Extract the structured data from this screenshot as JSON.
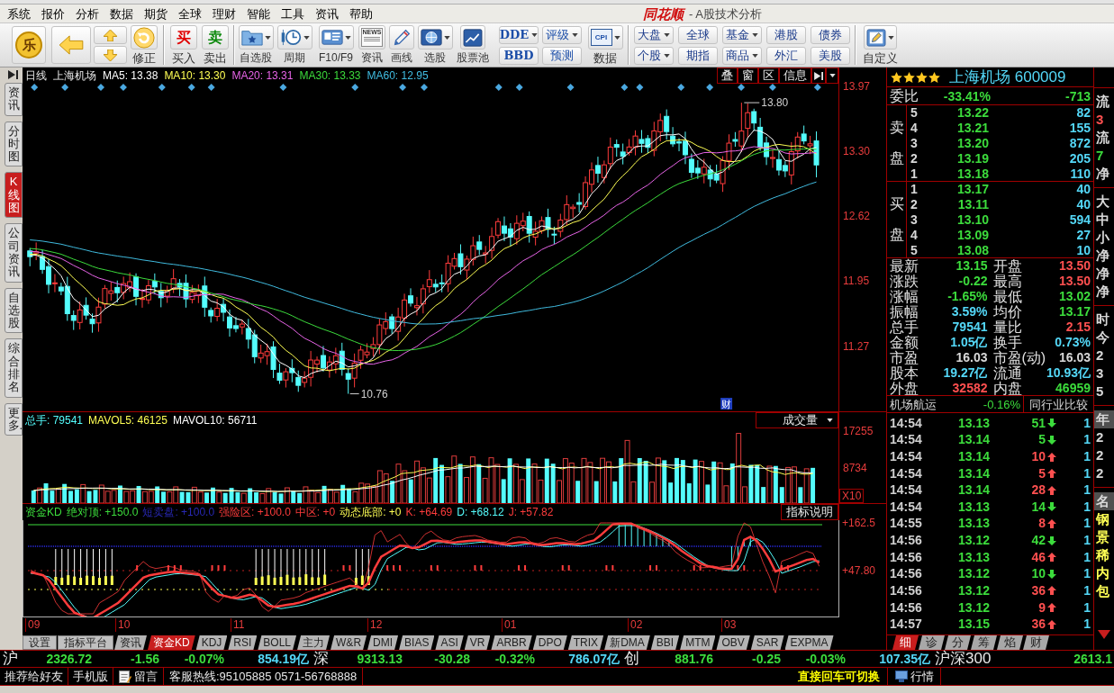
{
  "menu": [
    "系统",
    "报价",
    "分析",
    "数据",
    "期货",
    "全球",
    "理财",
    "智能",
    "工具",
    "资讯",
    "帮助"
  ],
  "title": {
    "logo": "同花顺",
    "caption": "- A股技术分析"
  },
  "toolbar": {
    "home": "乐",
    "fix": "修正",
    "trade": [
      {
        "icon_text": "买",
        "label": "买入",
        "color": "#e00000"
      },
      {
        "icon_text": "卖",
        "label": "卖出",
        "color": "#108a10"
      }
    ],
    "tools": [
      {
        "label": "自选股",
        "dropdown": true
      },
      {
        "label": "周期",
        "dropdown": true
      },
      {
        "label": "F10/F9",
        "dropdown": true
      },
      {
        "label": "资讯",
        "dropdown": false,
        "icon_text": "NEWS"
      },
      {
        "label": "画线",
        "dropdown": false
      },
      {
        "label": "选股",
        "dropdown": true
      },
      {
        "label": "股票池",
        "dropdown": false
      }
    ],
    "pairs": [
      [
        {
          "label": "DDE",
          "dropdown": true
        },
        {
          "label": "BBD",
          "dropdown": false
        }
      ],
      [
        {
          "label": "评级",
          "dropdown": true
        },
        {
          "label": "预测",
          "dropdown": false
        }
      ]
    ],
    "data": {
      "icon_text": "CPI",
      "label": "数据",
      "dropdown": true
    },
    "markets": [
      [
        {
          "label": "大盘",
          "dropdown": true
        },
        {
          "label": "个股",
          "dropdown": true
        }
      ],
      [
        {
          "label": "全球",
          "dropdown": false
        },
        {
          "label": "期指",
          "dropdown": false
        }
      ],
      [
        {
          "label": "基金",
          "dropdown": true
        },
        {
          "label": "商品",
          "dropdown": true
        }
      ],
      [
        {
          "label": "港股",
          "dropdown": false
        },
        {
          "label": "外汇",
          "dropdown": false
        }
      ],
      [
        {
          "label": "债券",
          "dropdown": false
        },
        {
          "label": "美股",
          "dropdown": false
        }
      ]
    ],
    "custom": {
      "label": "自定义",
      "dropdown": true
    }
  },
  "side_tabs": [
    {
      "label": "资讯",
      "selected": false
    },
    {
      "label": "分时图",
      "selected": false
    },
    {
      "label": "K线图",
      "selected": true
    },
    {
      "label": "公司资讯",
      "selected": false
    },
    {
      "label": "自选股",
      "selected": false
    },
    {
      "label": "综合排名",
      "selected": false
    },
    {
      "label": "更多..",
      "selected": false
    }
  ],
  "kline": {
    "period": "日线",
    "stock": "上海机场",
    "ma": [
      {
        "label": "MA5: 13.38",
        "color": "#ffffff"
      },
      {
        "label": "MA10: 13.30",
        "color": "#ffff54"
      },
      {
        "label": "MA20: 13.31",
        "color": "#e864e8"
      },
      {
        "label": "MA30: 13.33",
        "color": "#3cdc3c"
      },
      {
        "label": "MA60: 12.95",
        "color": "#40bce0"
      }
    ],
    "buttons": [
      "叠",
      "窗",
      "区",
      "信息"
    ],
    "price_ticks": [
      "13.97",
      "13.30",
      "12.62",
      "11.95",
      "11.27"
    ],
    "high_label": "13.80",
    "low_label": "10.76",
    "event_marker": "财"
  },
  "volume": {
    "stats": [
      {
        "label": "总手: 79541",
        "color": "#54fcfc"
      },
      {
        "label": "MAVOL5: 46125",
        "color": "#ffff54"
      },
      {
        "label": "MAVOL10: 56711",
        "color": "#ffffff"
      }
    ],
    "selector": "成交量",
    "ticks": [
      "17255",
      "8734"
    ],
    "unit": "X10"
  },
  "indicator": {
    "items": [
      {
        "label": "资金KD",
        "color": "#3cdc3c"
      },
      {
        "label": "绝对顶: +150.0",
        "color": "#3cdc3c"
      },
      {
        "label": "短卖盘: +100.0",
        "color": "#2828b4"
      },
      {
        "label": "强险区: +100.0",
        "color": "#ff3c3c"
      },
      {
        "label": "中区: +0",
        "color": "#ff3c3c"
      },
      {
        "label": "动态底部: +0",
        "color": "#ffff54"
      },
      {
        "label": "K: +64.69",
        "color": "#ff3c3c"
      },
      {
        "label": "D: +68.12",
        "color": "#54fcfc"
      },
      {
        "label": "J: +57.82",
        "color": "#ff3c3c"
      }
    ],
    "help_button": "指标说明",
    "ticks": [
      "+162.5",
      "+47.80"
    ]
  },
  "months": [
    "09",
    "10",
    "11",
    "12",
    "01",
    "02",
    "03"
  ],
  "indicator_tabs": [
    {
      "label": "设置",
      "kind": "button",
      "selected": false
    },
    {
      "label": "指标平台",
      "kind": "button",
      "selected": false
    },
    {
      "label": "资讯",
      "kind": "tab",
      "selected": false
    },
    {
      "label": "资金KD",
      "kind": "tab",
      "selected": true
    },
    {
      "label": "KDJ",
      "kind": "tab",
      "selected": false
    },
    {
      "label": "RSI",
      "kind": "tab",
      "selected": false
    },
    {
      "label": "BOLL",
      "kind": "tab",
      "selected": false
    },
    {
      "label": "主力",
      "kind": "tab",
      "selected": false
    },
    {
      "label": "W&R",
      "kind": "tab",
      "selected": false
    },
    {
      "label": "DMI",
      "kind": "tab",
      "selected": false
    },
    {
      "label": "BIAS",
      "kind": "tab",
      "selected": false
    },
    {
      "label": "ASI",
      "kind": "tab",
      "selected": false
    },
    {
      "label": "VR",
      "kind": "tab",
      "selected": false
    },
    {
      "label": "ARBR",
      "kind": "tab",
      "selected": false
    },
    {
      "label": "DPO",
      "kind": "tab",
      "selected": false
    },
    {
      "label": "TRIX",
      "kind": "tab",
      "selected": false
    },
    {
      "label": "新DMA",
      "kind": "tab",
      "selected": false
    },
    {
      "label": "BBI",
      "kind": "tab",
      "selected": false
    },
    {
      "label": "MTM",
      "kind": "tab",
      "selected": false
    },
    {
      "label": "OBV",
      "kind": "tab",
      "selected": false
    },
    {
      "label": "SAR",
      "kind": "tab",
      "selected": false
    },
    {
      "label": "EXPMA",
      "kind": "tab",
      "selected": false
    }
  ],
  "quote": {
    "stars": 4,
    "name": "上海机场 600009",
    "ratio": {
      "label": "委比",
      "percent": "-33.41%",
      "diff": "-713"
    },
    "asks": {
      "label": "卖盘",
      "rows": [
        {
          "rank": "5",
          "price": "13.22",
          "volume": "82"
        },
        {
          "rank": "4",
          "price": "13.21",
          "volume": "155"
        },
        {
          "rank": "3",
          "price": "13.20",
          "volume": "872"
        },
        {
          "rank": "2",
          "price": "13.19",
          "volume": "205"
        },
        {
          "rank": "1",
          "price": "13.18",
          "volume": "110"
        }
      ]
    },
    "bids": {
      "label": "买盘",
      "rows": [
        {
          "rank": "1",
          "price": "13.17",
          "volume": "40"
        },
        {
          "rank": "2",
          "price": "13.11",
          "volume": "40"
        },
        {
          "rank": "3",
          "price": "13.10",
          "volume": "594"
        },
        {
          "rank": "4",
          "price": "13.09",
          "volume": "27"
        },
        {
          "rank": "5",
          "price": "13.08",
          "volume": "10"
        }
      ]
    },
    "stats": [
      {
        "label": "最新",
        "value": "13.15",
        "color": "#3cdc3c"
      },
      {
        "label": "开盘",
        "value": "13.50",
        "color": "#ff5050"
      },
      {
        "label": "涨跌",
        "value": "-0.22",
        "color": "#3cdc3c"
      },
      {
        "label": "最高",
        "value": "13.50",
        "color": "#ff5050"
      },
      {
        "label": "涨幅",
        "value": "-1.65%",
        "color": "#3cdc3c"
      },
      {
        "label": "最低",
        "value": "13.02",
        "color": "#3cdc3c"
      },
      {
        "label": "振幅",
        "value": "3.59%",
        "color": "#54d8f8"
      },
      {
        "label": "均价",
        "value": "13.17",
        "color": "#3cdc3c"
      },
      {
        "label": "总手",
        "value": "79541",
        "color": "#54d8f8"
      },
      {
        "label": "量比",
        "value": "2.15",
        "color": "#ff5050"
      },
      {
        "label": "金额",
        "value": "1.05亿",
        "color": "#54d8f8"
      },
      {
        "label": "换手",
        "value": "0.73%",
        "color": "#54d8f8"
      },
      {
        "label": "市盈",
        "value": "16.03",
        "color": "#d8d8d8"
      },
      {
        "label": "市盈(动)",
        "value": "16.03",
        "color": "#d8d8d8"
      },
      {
        "label": "股本",
        "value": "19.27亿",
        "color": "#54d8f8"
      },
      {
        "label": "流通",
        "value": "10.93亿",
        "color": "#54d8f8"
      },
      {
        "label": "外盘",
        "value": "32582",
        "color": "#ff5050"
      },
      {
        "label": "内盘",
        "value": "46959",
        "color": "#3cdc3c"
      }
    ],
    "industry": {
      "name": "机场航运",
      "change": "-0.16%",
      "button": "同行业比较"
    },
    "ticks": [
      {
        "time": "14:54",
        "price": "13.13",
        "volume": "51",
        "kind": "down",
        "column_4": "1"
      },
      {
        "time": "14:54",
        "price": "13.14",
        "volume": "5",
        "kind": "down",
        "column_4": "1"
      },
      {
        "time": "14:54",
        "price": "13.14",
        "volume": "10",
        "kind": "up",
        "column_4": "1"
      },
      {
        "time": "14:54",
        "price": "13.14",
        "volume": "5",
        "kind": "up",
        "column_4": "1"
      },
      {
        "time": "14:54",
        "price": "13.14",
        "volume": "28",
        "kind": "up",
        "column_4": "1"
      },
      {
        "time": "14:54",
        "price": "13.13",
        "volume": "14",
        "kind": "down",
        "column_4": "1"
      },
      {
        "time": "14:55",
        "price": "13.13",
        "volume": "8",
        "kind": "up",
        "column_4": "1"
      },
      {
        "time": "14:56",
        "price": "13.12",
        "volume": "42",
        "kind": "down",
        "column_4": "1"
      },
      {
        "time": "14:56",
        "price": "13.13",
        "volume": "46",
        "kind": "up",
        "column_4": "1"
      },
      {
        "time": "14:56",
        "price": "13.12",
        "volume": "10",
        "kind": "down",
        "column_4": "1"
      },
      {
        "time": "14:56",
        "price": "13.12",
        "volume": "36",
        "kind": "up",
        "column_4": "1"
      },
      {
        "time": "14:56",
        "price": "13.12",
        "volume": "9",
        "kind": "up",
        "column_4": "1"
      },
      {
        "time": "14:57",
        "price": "13.15",
        "volume": "36",
        "kind": "up",
        "column_4": "1"
      }
    ],
    "tabs": [
      {
        "label": "细",
        "selected": true
      },
      {
        "label": "诊",
        "selected": false
      },
      {
        "label": "分",
        "selected": false
      },
      {
        "label": "筹",
        "selected": false
      },
      {
        "label": "焰",
        "selected": false
      },
      {
        "label": "财",
        "selected": false
      }
    ]
  },
  "side_panel": [
    [
      {
        "text": "流",
        "kind": "text",
        "color": "#d8d8d8"
      },
      {
        "text": "3",
        "kind": "text",
        "color": "#ff5050"
      },
      {
        "text": "流",
        "kind": "text",
        "color": "#d8d8d8"
      },
      {
        "text": "7",
        "kind": "text",
        "color": "#3cdc3c"
      },
      {
        "text": "净",
        "kind": "text",
        "color": "#d8d8d8"
      }
    ],
    [
      {
        "text": "大",
        "kind": "text",
        "color": "#d8d8d8"
      },
      {
        "text": "中",
        "kind": "text",
        "color": "#d8d8d8"
      },
      {
        "text": "小",
        "kind": "text",
        "color": "#d8d8d8"
      },
      {
        "text": "净",
        "kind": "text",
        "color": "#d8d8d8"
      },
      {
        "text": "净",
        "kind": "text",
        "color": "#d8d8d8"
      },
      {
        "text": "净",
        "kind": "text",
        "color": "#d8d8d8"
      }
    ],
    [
      {
        "text": "时",
        "kind": "text",
        "color": "#d8d8d8"
      },
      {
        "text": "今",
        "kind": "text",
        "color": "#d8d8d8"
      },
      {
        "text": "2",
        "kind": "text",
        "color": "#d8d8d8"
      },
      {
        "text": "3",
        "kind": "text",
        "color": "#d8d8d8"
      },
      {
        "text": "5",
        "kind": "text",
        "color": "#d8d8d8"
      }
    ],
    [
      {
        "text": "年",
        "kind": "header"
      },
      {
        "text": "2",
        "kind": "text",
        "color": "#d8d8d8"
      },
      {
        "text": "2",
        "kind": "text",
        "color": "#d8d8d8"
      },
      {
        "text": "2",
        "kind": "text",
        "color": "#d8d8d8"
      }
    ],
    [
      {
        "text": "名",
        "kind": "header"
      },
      {
        "text": "钢",
        "kind": "text",
        "color": "#ffff54"
      },
      {
        "text": "景",
        "kind": "text",
        "color": "#ffff54"
      },
      {
        "text": "稀",
        "kind": "text",
        "color": "#ffff54"
      },
      {
        "text": "内",
        "kind": "text",
        "color": "#ffff54"
      },
      {
        "text": "包",
        "kind": "text",
        "color": "#ffff54"
      }
    ]
  ],
  "index_bar": [
    {
      "name": "沪",
      "value": "2326.72",
      "change": "-1.56",
      "percent": "-0.07%",
      "amount": "854.19亿"
    },
    {
      "name": "深",
      "value": "9313.13",
      "change": "-30.28",
      "percent": "-0.32%",
      "amount": "786.07亿"
    },
    {
      "name": "创",
      "value": "881.76",
      "change": "-0.25",
      "percent": "-0.03%",
      "amount": "107.35亿"
    },
    {
      "name": "沪深300",
      "value": "2613.1"
    }
  ],
  "status_bar": {
    "links": [
      "推荐给好友",
      "手机版"
    ],
    "message": "留言",
    "hotline": "客服热线:95105885 0571-56768888",
    "hint": "直接回车可切换",
    "quote_button": "行情"
  }
}
